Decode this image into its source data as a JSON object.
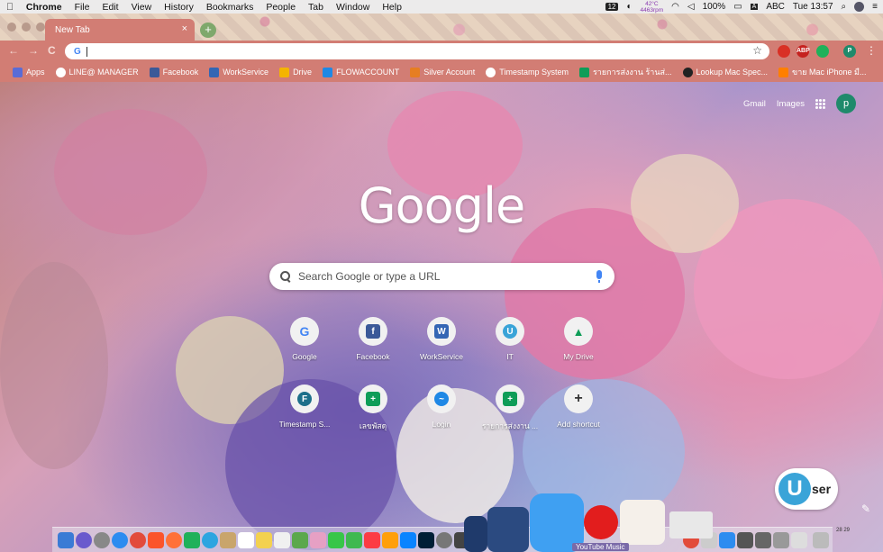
{
  "menubar": {
    "app": "Chrome",
    "items": [
      "File",
      "Edit",
      "View",
      "History",
      "Bookmarks",
      "People",
      "Tab",
      "Window",
      "Help"
    ],
    "badge": "12",
    "temp": "42°C",
    "rpm": "4463rpm",
    "battery": "100%",
    "input_source": "ABC",
    "clock": "Tue 13:57"
  },
  "tab": {
    "title": "New Tab",
    "close_glyph": "×",
    "new_tab_glyph": "+"
  },
  "toolbar": {
    "back_glyph": "←",
    "forward_glyph": "→",
    "reload_glyph": "C",
    "omnibox_icon": "G",
    "omnibox_value": "",
    "star_glyph": "☆",
    "extensions": [
      {
        "name": "shield-extension",
        "label": "",
        "color": "#d93025"
      },
      {
        "name": "abp-extension",
        "label": "ABP",
        "color": "#c5221f"
      },
      {
        "name": "line-extension",
        "label": "",
        "color": "#1fb15a"
      },
      {
        "name": "profile-extension",
        "label": "P",
        "color": "#1f8a6b"
      }
    ]
  },
  "bookmarks": [
    {
      "label": "Apps",
      "color": "#5a6cd6"
    },
    {
      "label": "LINE@ MANAGER",
      "color": "#ffffff"
    },
    {
      "label": "Facebook",
      "color": "#3b5998"
    },
    {
      "label": "WorkService",
      "color": "#3466b4"
    },
    {
      "label": "Drive",
      "color": "#f4b400"
    },
    {
      "label": "FLOWACCOUNT",
      "color": "#1e88e5"
    },
    {
      "label": "Silver Account",
      "color": "#e67e22"
    },
    {
      "label": "Timestamp System",
      "color": "#ffffff"
    },
    {
      "label": "รายการส่งงาน ร้านส่...",
      "color": "#0f9d58"
    },
    {
      "label": "Lookup Mac Spec...",
      "color": "#222222"
    },
    {
      "label": "ขาย Mac iPhone มื...",
      "color": "#ff7f00"
    }
  ],
  "ntp": {
    "gmail": "Gmail",
    "images": "Images",
    "avatar_letter": "p",
    "logo": "Google",
    "search_placeholder": "Search Google or type a URL",
    "shortcuts": [
      {
        "label": "Google",
        "glyph": "G",
        "color": "#4285f4"
      },
      {
        "label": "Facebook",
        "glyph": "f",
        "color": "#3b5998"
      },
      {
        "label": "WorkService",
        "glyph": "W",
        "color": "#3466b4"
      },
      {
        "label": "IT",
        "glyph": "U",
        "color": "#3aa4d8"
      },
      {
        "label": "My Drive",
        "glyph": "▲",
        "color": "#0f9d58"
      },
      {
        "label": "Timestamp S...",
        "glyph": "F",
        "color": "#1d6f8a"
      },
      {
        "label": "เลขพัสดุ",
        "glyph": "+",
        "color": "#0f9d58"
      },
      {
        "label": "Login",
        "glyph": "~",
        "color": "#1e88e5"
      },
      {
        "label": "รายการส่งงาน ...",
        "glyph": "+",
        "color": "#0f9d58"
      },
      {
        "label": "Add shortcut",
        "glyph": "+",
        "color": "#333333"
      }
    ],
    "customize_glyph": "✎",
    "user_logo_u": "U",
    "user_logo_rest": "ser"
  },
  "dock": {
    "youtube_label": "YouTube Music",
    "calendar": "28 29"
  }
}
